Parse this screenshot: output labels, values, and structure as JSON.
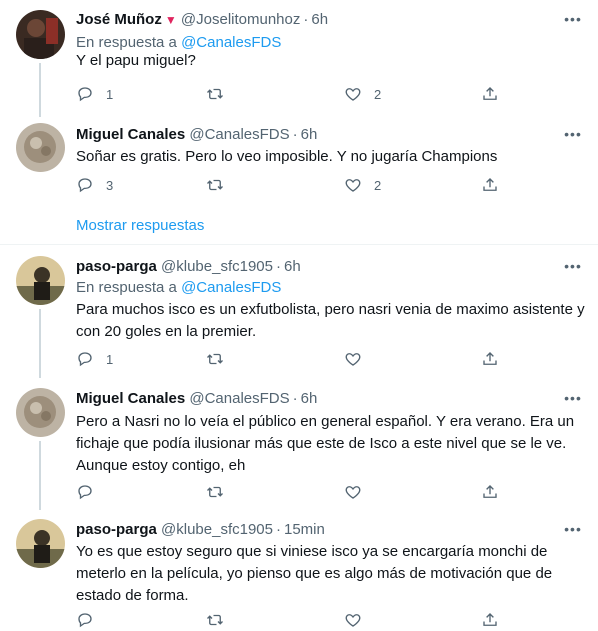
{
  "tweets": [
    {
      "name": "José Muñoz",
      "badge": "▼",
      "handle": "@Joselitomunhoz",
      "time": "6h",
      "reply_prefix": "En respuesta a",
      "reply_to": "@CanalesFDS",
      "text": "Y el papu miguel?",
      "replies": "1",
      "retweets": "",
      "likes": "2"
    },
    {
      "name": "Miguel Canales",
      "handle": "@CanalesFDS",
      "time": "6h",
      "text": "Soñar es gratis. Pero lo veo imposible. Y no jugaría Champions",
      "replies": "3",
      "retweets": "",
      "likes": "2"
    },
    {
      "name": "paso-parga",
      "handle": "@klube_sfc1905",
      "time": "6h",
      "reply_prefix": "En respuesta a",
      "reply_to": "@CanalesFDS",
      "text": "Para muchos isco es un exfutbolista, pero nasri venia de maximo asistente y con 20 goles en la premier.",
      "replies": "1",
      "retweets": "",
      "likes": ""
    },
    {
      "name": "Miguel Canales",
      "handle": "@CanalesFDS",
      "time": "6h",
      "text": "Pero a Nasri no lo veía el público en general español. Y era verano. Era un fichaje que podía ilusionar más que este de Isco a este nivel que se le ve. Aunque estoy contigo, eh",
      "replies": "",
      "retweets": "",
      "likes": ""
    },
    {
      "name": "paso-parga",
      "handle": "@klube_sfc1905",
      "time": "15min",
      "text": "Yo es que estoy seguro que si viniese isco ya se encargaría monchi de meterlo en la película, yo pienso que es algo más de motivación que de estado de forma.",
      "replies": "",
      "retweets": "",
      "likes": ""
    }
  ],
  "show_replies": "Mostrar respuestas",
  "icons": {
    "reply": "reply-icon",
    "retweet": "retweet-icon",
    "like": "heart-icon",
    "share": "share-icon",
    "more": "more-icon"
  },
  "colors": {
    "link": "#1d9bf0",
    "secondary": "#536471",
    "badge": "#e0245e"
  }
}
